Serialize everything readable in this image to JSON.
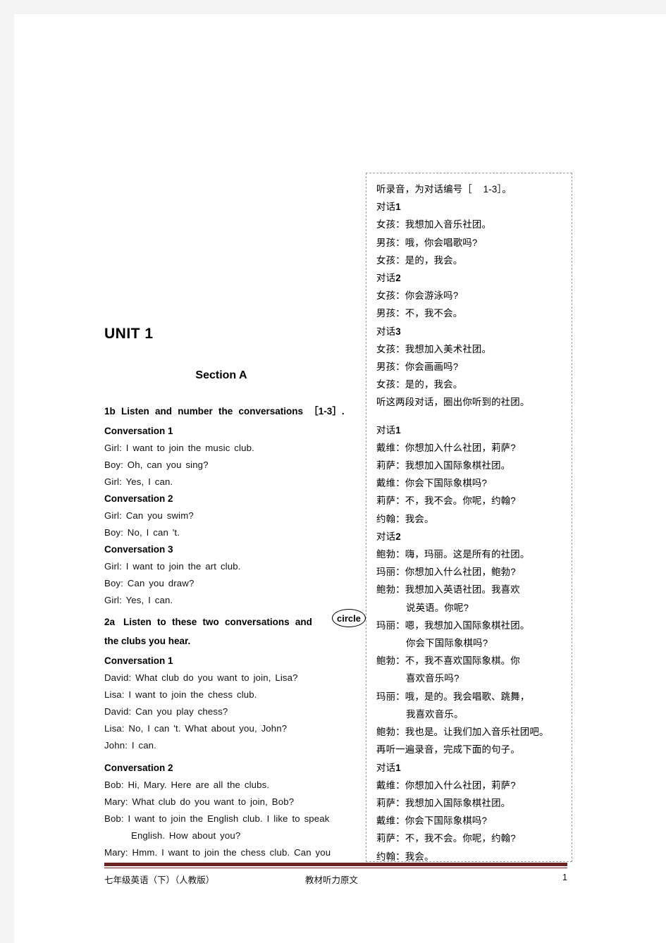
{
  "document": {
    "unit_title": "UNIT 1",
    "section_title": "Section A"
  },
  "left_column": {
    "task_1b": "1b    Listen and number the conversations ［1-3］.",
    "task_1b_num": "1b",
    "task_1b_text": "Listen and number the conversations ［1-3］.",
    "blocks": [
      {
        "heading": "Conversation 1",
        "lines": [
          "Girl: I want to join the music club.",
          "Boy: Oh, can you sing?",
          "Girl: Yes, I can."
        ]
      },
      {
        "heading": "Conversation 2",
        "lines": [
          "Girl: Can you swim?",
          "Boy: No, I can 't."
        ]
      },
      {
        "heading": "Conversation 3",
        "lines": [
          "Girl: I want to join the art club.",
          "Boy: Can you draw?",
          "Girl: Yes, I can."
        ]
      }
    ],
    "task_2a_num": "2a",
    "task_2a_line1": "Listen to these two conversations and",
    "task_2a_line2": "the clubs you hear.",
    "task_2a_circle_word": "circle",
    "blocks2": [
      {
        "heading": "Conversation 1",
        "lines": [
          "David: What club do you want to join, Lisa?",
          "Lisa: I want to join the chess club.",
          "David: Can you play chess?",
          "Lisa: No, I can 't. What about you, John?",
          "John: I can."
        ]
      },
      {
        "heading": "Conversation 2",
        "lines": [
          "Bob: Hi, Mary. Here are all the clubs.",
          "Mary: What club do you want to join, Bob?",
          "Bob: I want to join the English club. I like to speak",
          "English. How about you?",
          "Mary: Hmm. I want to join the chess club. Can you"
        ],
        "indent_flags": [
          false,
          false,
          false,
          true,
          false
        ]
      }
    ]
  },
  "right_column": {
    "lines": [
      {
        "text": "听录音，为对话编号［    1-3］。",
        "bold_tail": "",
        "indent": false
      },
      {
        "text": "对话",
        "bold_tail": "1",
        "indent": false
      },
      {
        "text": "女孩：我想加入音乐社团。",
        "bold_tail": "",
        "indent": false
      },
      {
        "text": "男孩：哦，你会唱歌吗?",
        "bold_tail": "",
        "indent": false
      },
      {
        "text": "女孩：是的，我会。",
        "bold_tail": "",
        "indent": false
      },
      {
        "text": "对话",
        "bold_tail": "2",
        "indent": false
      },
      {
        "text": "女孩：你会游泳吗?",
        "bold_tail": "",
        "indent": false
      },
      {
        "text": "男孩：不，我不会。",
        "bold_tail": "",
        "indent": false
      },
      {
        "text": "对话",
        "bold_tail": "3",
        "indent": false
      },
      {
        "text": "女孩：我想加入美术社团。",
        "bold_tail": "",
        "indent": false
      },
      {
        "text": "男孩：你会画画吗?",
        "bold_tail": "",
        "indent": false
      },
      {
        "text": "女孩：是的，我会。",
        "bold_tail": "",
        "indent": false
      },
      {
        "text": "听这两段对话，圈出你听到的社团。",
        "bold_tail": "",
        "indent": false
      },
      {
        "text": "",
        "bold_tail": "",
        "indent": false,
        "blank": true
      },
      {
        "text": "对话",
        "bold_tail": "1",
        "indent": false
      },
      {
        "text": "戴维：你想加入什么社团，莉萨?",
        "bold_tail": "",
        "indent": false
      },
      {
        "text": "莉萨：我想加入国际象棋社团。",
        "bold_tail": "",
        "indent": false
      },
      {
        "text": "戴维：你会下国际象棋吗?",
        "bold_tail": "",
        "indent": false
      },
      {
        "text": "莉萨：不，我不会。你呢，约翰?",
        "bold_tail": "",
        "indent": false
      },
      {
        "text": "约翰：我会。",
        "bold_tail": "",
        "indent": false
      },
      {
        "text": "对话",
        "bold_tail": "2",
        "indent": false
      },
      {
        "text": "鲍勃：嗨，玛丽。这是所有的社团。",
        "bold_tail": "",
        "indent": false
      },
      {
        "text": "玛丽：你想加入什么社团，鲍勃?",
        "bold_tail": "",
        "indent": false
      },
      {
        "text": "鲍勃：我想加入英语社团。我喜欢",
        "bold_tail": "",
        "indent": false
      },
      {
        "text": "说英语。你呢?",
        "bold_tail": "",
        "indent": true
      },
      {
        "text": "玛丽：嗯，我想加入国际象棋社团。",
        "bold_tail": "",
        "indent": false
      },
      {
        "text": "你会下国际象棋吗?",
        "bold_tail": "",
        "indent": true
      },
      {
        "text": "鲍勃：不，我不喜欢国际象棋。你",
        "bold_tail": "",
        "indent": false
      },
      {
        "text": "喜欢音乐吗?",
        "bold_tail": "",
        "indent": true
      },
      {
        "text": "玛丽：哦，是的。我会唱歌、跳舞，",
        "bold_tail": "",
        "indent": false
      },
      {
        "text": "我喜欢音乐。",
        "bold_tail": "",
        "indent": true
      },
      {
        "text": "鲍勃：我也是。让我们加入音乐社团吧。",
        "bold_tail": "",
        "indent": false
      },
      {
        "text": "再听一遍录音，完成下面的句子。",
        "bold_tail": "",
        "indent": false
      },
      {
        "text": "对话",
        "bold_tail": "1",
        "indent": false
      },
      {
        "text": "戴维：你想加入什么社团，莉萨?",
        "bold_tail": "",
        "indent": false
      },
      {
        "text": "莉萨：我想加入国际象棋社团。",
        "bold_tail": "",
        "indent": false
      },
      {
        "text": "戴维：你会下国际象棋吗?",
        "bold_tail": "",
        "indent": false
      },
      {
        "text": "莉萨：不，我不会。你呢，约翰?",
        "bold_tail": "",
        "indent": false
      },
      {
        "text": "约翰：我会。",
        "bold_tail": "",
        "indent": false
      }
    ]
  },
  "footer": {
    "left": "七年级英语（下）（人教版）",
    "center": "教材听力原文",
    "page_number": "1",
    "rule_color": "#6b2223"
  }
}
